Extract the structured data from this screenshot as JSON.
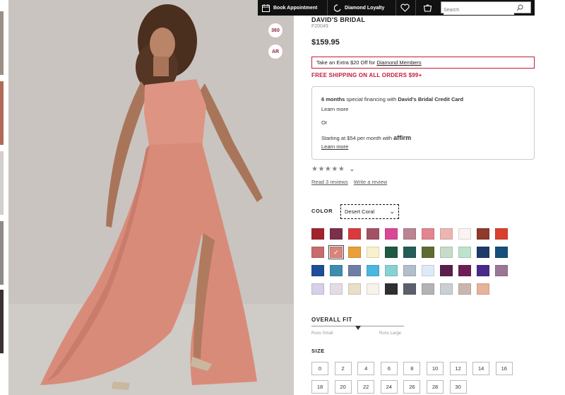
{
  "toolbar": {
    "book_appointment": "Book Appointment",
    "diamond_loyalty": "Diamond Loyalty",
    "search_placeholder": "Search"
  },
  "image_badges": {
    "badge_360": "360",
    "badge_ar": "AR"
  },
  "product": {
    "brand": "DAVID'S BRIDAL",
    "sku": "F20049",
    "price": "$159.95",
    "promo_prefix": "Take an Extra $20 Off for ",
    "promo_link": "Diamond Members",
    "free_shipping": "FREE SHIPPING ON ALL ORDERS $99+"
  },
  "financing": {
    "months_bold": "6 months",
    "months_text": " special financing with ",
    "card_bold": "David's Bridal Credit Card",
    "learn_more_1": "Learn more",
    "or": "Or",
    "starting_text": "Starting at $54 per month with ",
    "affirm": "affirm",
    "learn_more_2": "Learn more"
  },
  "reviews": {
    "rating": 3.5,
    "stars_text": "★★★★★",
    "chevron": "⌄",
    "read_reviews": "Read 3 reviews",
    "write_review": "Write a review"
  },
  "color": {
    "label": "COLOR",
    "selected": "Desert Coral",
    "check": "✓",
    "selected_index": 12,
    "swatches": [
      "#a1242c",
      "#7a2f4b",
      "#d83a3e",
      "#a35266",
      "#d94896",
      "#b88591",
      "#e3858e",
      "#ebb6b2",
      "#fbf3f2",
      "#8f3a2a",
      "#d9412e",
      "#c76b6c",
      "#d9847a",
      "#e9a03a",
      "#f8f1cb",
      "#1f5a41",
      "#245c58",
      "#5e6c32",
      "#c6dcc9",
      "#bde3cc",
      "#1c3b6a",
      "#164e7e",
      "#1f4d97",
      "#3e8cae",
      "#6f7ea6",
      "#4cb6df",
      "#88d1d3",
      "#b1bfcc",
      "#ddeaf7",
      "#5a1f4c",
      "#6e1e56",
      "#4a2a8c",
      "#9a7795",
      "#d6d0e8",
      "#e3dce6",
      "#e9dfc9",
      "#f6f4ea",
      "#2f2f2f",
      "#5d606c",
      "#b3b3b3",
      "#c9cfd3",
      "#cbb6ae",
      "#e6b49b"
    ]
  },
  "fit": {
    "label": "OVERALL FIT",
    "left": "Runs Small",
    "right": "Runs Large",
    "position": 0.5
  },
  "size": {
    "label": "SIZE",
    "row1": [
      "0",
      "2",
      "4",
      "6",
      "8",
      "10",
      "12",
      "14",
      "16"
    ],
    "row2": [
      "18",
      "20",
      "22",
      "24",
      "26",
      "28",
      "30"
    ]
  }
}
